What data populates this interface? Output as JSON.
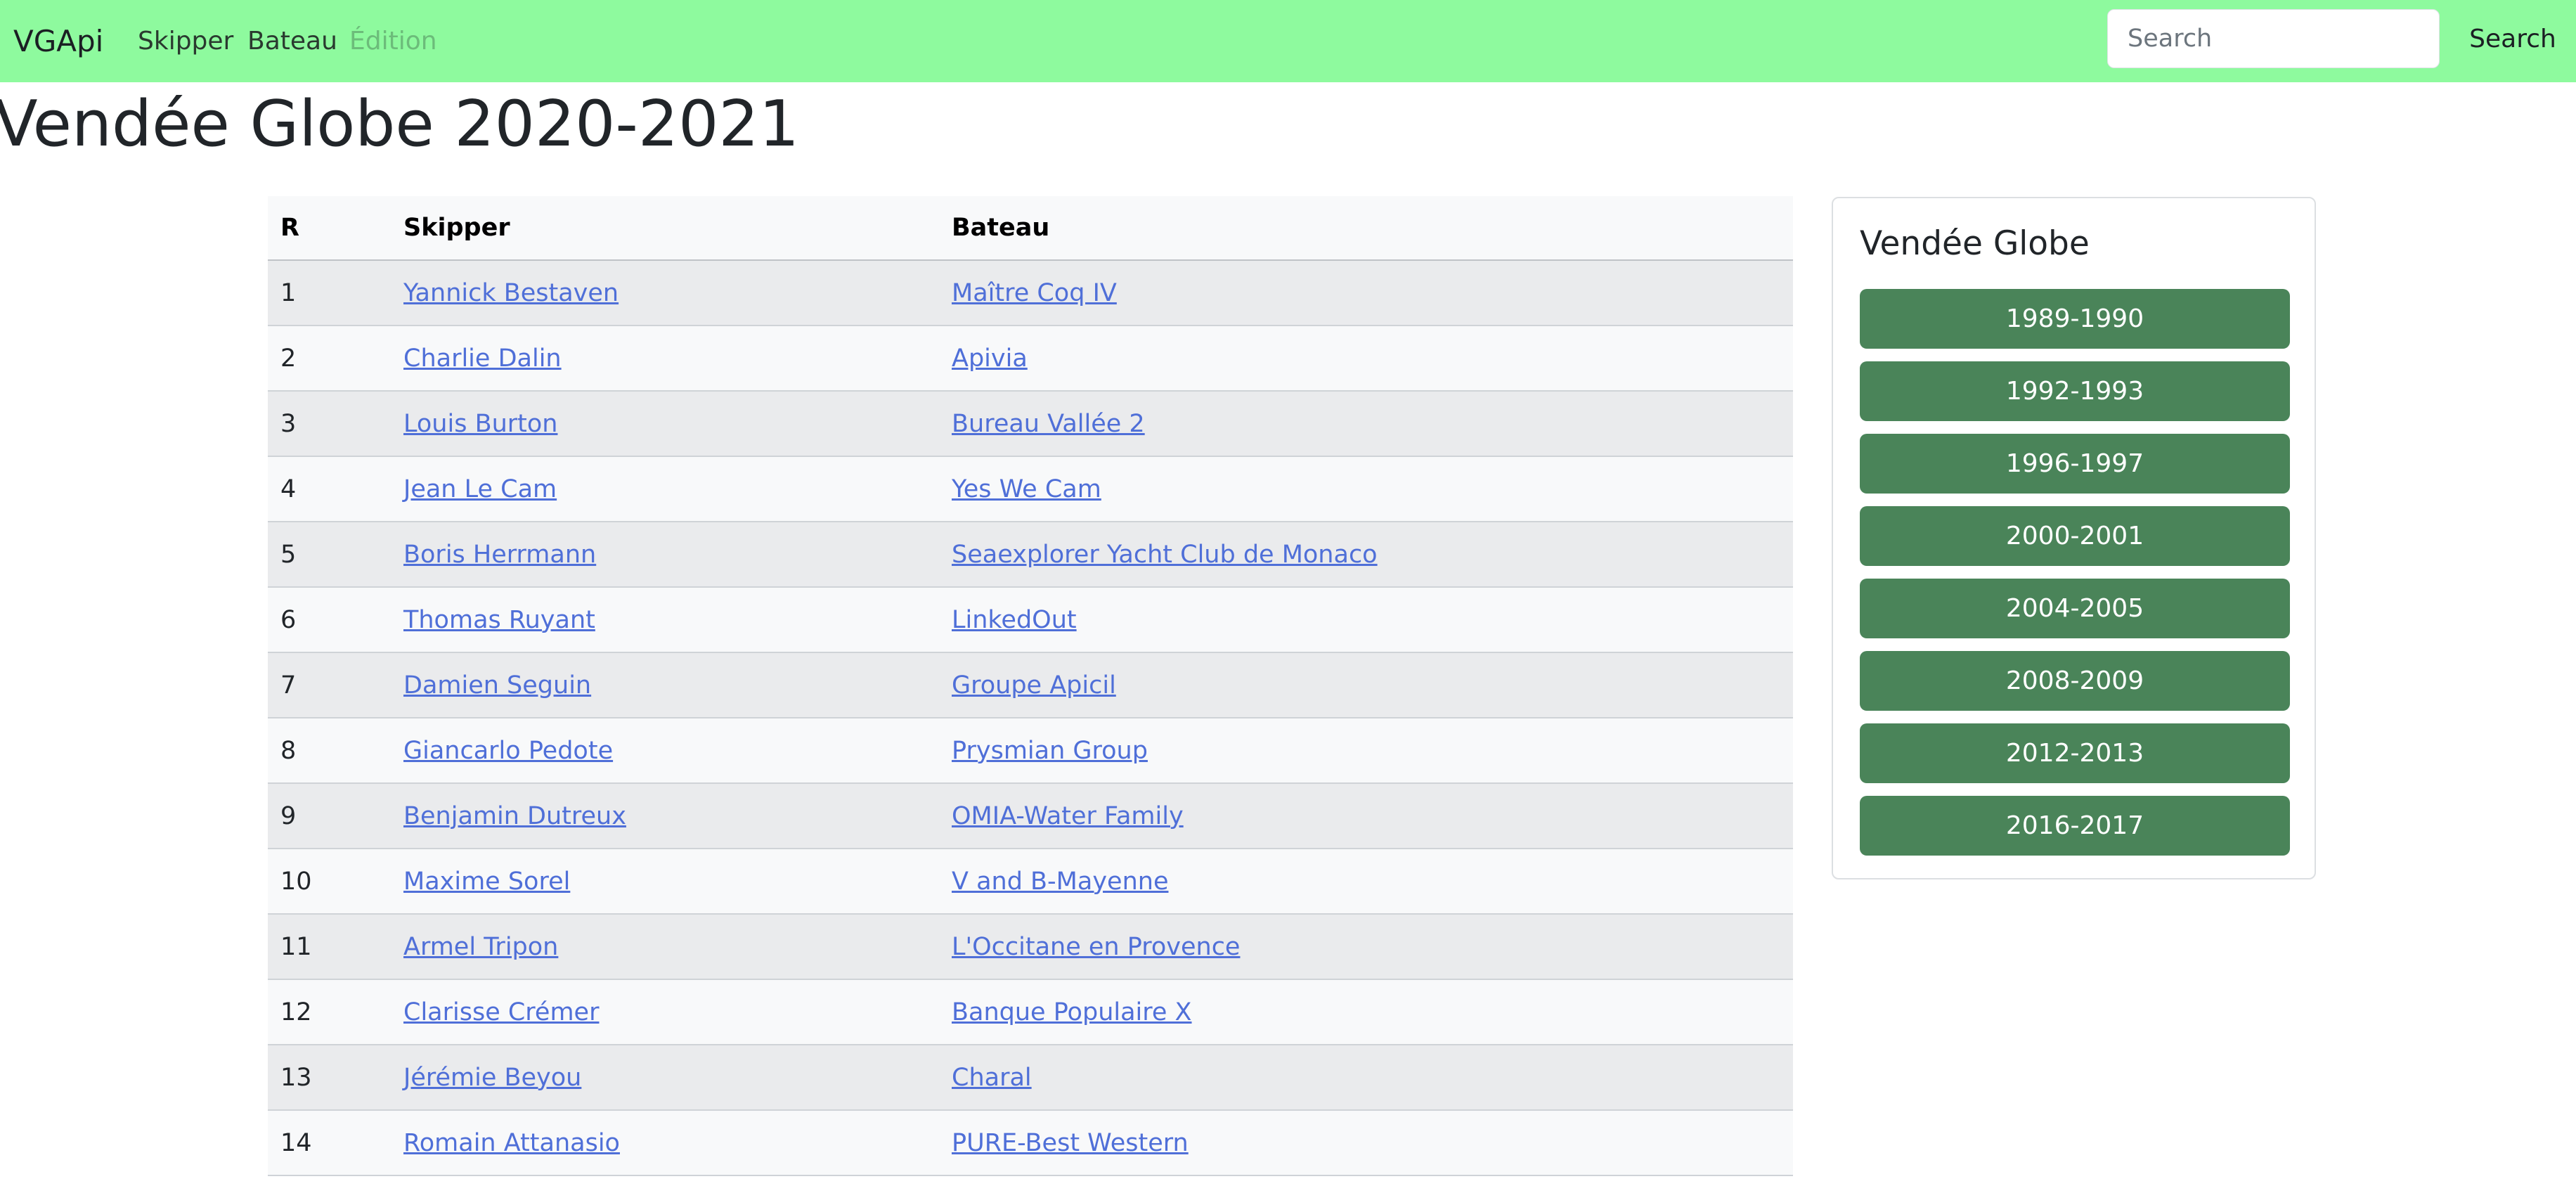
{
  "navbar": {
    "brand": "VGApi",
    "links": [
      {
        "label": "Skipper"
      },
      {
        "label": "Bateau"
      },
      {
        "label": "Édition",
        "disabled": true
      }
    ],
    "search_placeholder": "Search",
    "search_button": "Search",
    "background_color": "#8efa9e"
  },
  "page": {
    "title": "Vendée Globe 2020-2021"
  },
  "table": {
    "headers": [
      "R",
      "Skipper",
      "Bateau"
    ],
    "rows": [
      {
        "rank": "1",
        "skipper": "Yannick Bestaven",
        "boat": "Maître Coq IV"
      },
      {
        "rank": "2",
        "skipper": "Charlie Dalin",
        "boat": "Apivia"
      },
      {
        "rank": "3",
        "skipper": "Louis Burton",
        "boat": "Bureau Vallée 2"
      },
      {
        "rank": "4",
        "skipper": "Jean Le Cam",
        "boat": "Yes We Cam"
      },
      {
        "rank": "5",
        "skipper": "Boris Herrmann",
        "boat": "Seaexplorer Yacht Club de Monaco"
      },
      {
        "rank": "6",
        "skipper": "Thomas Ruyant",
        "boat": "LinkedOut"
      },
      {
        "rank": "7",
        "skipper": "Damien Seguin",
        "boat": "Groupe Apicil"
      },
      {
        "rank": "8",
        "skipper": "Giancarlo Pedote",
        "boat": "Prysmian Group"
      },
      {
        "rank": "9",
        "skipper": "Benjamin Dutreux",
        "boat": "OMIA-Water Family"
      },
      {
        "rank": "10",
        "skipper": "Maxime Sorel",
        "boat": "V and B-Mayenne"
      },
      {
        "rank": "11",
        "skipper": "Armel Tripon",
        "boat": "L'Occitane en Provence"
      },
      {
        "rank": "12",
        "skipper": "Clarisse Crémer",
        "boat": "Banque Populaire X"
      },
      {
        "rank": "13",
        "skipper": "Jérémie Beyou",
        "boat": "Charal"
      },
      {
        "rank": "14",
        "skipper": "Romain Attanasio",
        "boat": "PURE-Best Western"
      }
    ],
    "link_color": "#4f6fd8"
  },
  "sidebar": {
    "title": "Vendée Globe",
    "editions": [
      "1989-1990",
      "1992-1993",
      "1996-1997",
      "2000-2001",
      "2004-2005",
      "2008-2009",
      "2012-2013",
      "2016-2017"
    ],
    "button_color": "#4a8459"
  }
}
